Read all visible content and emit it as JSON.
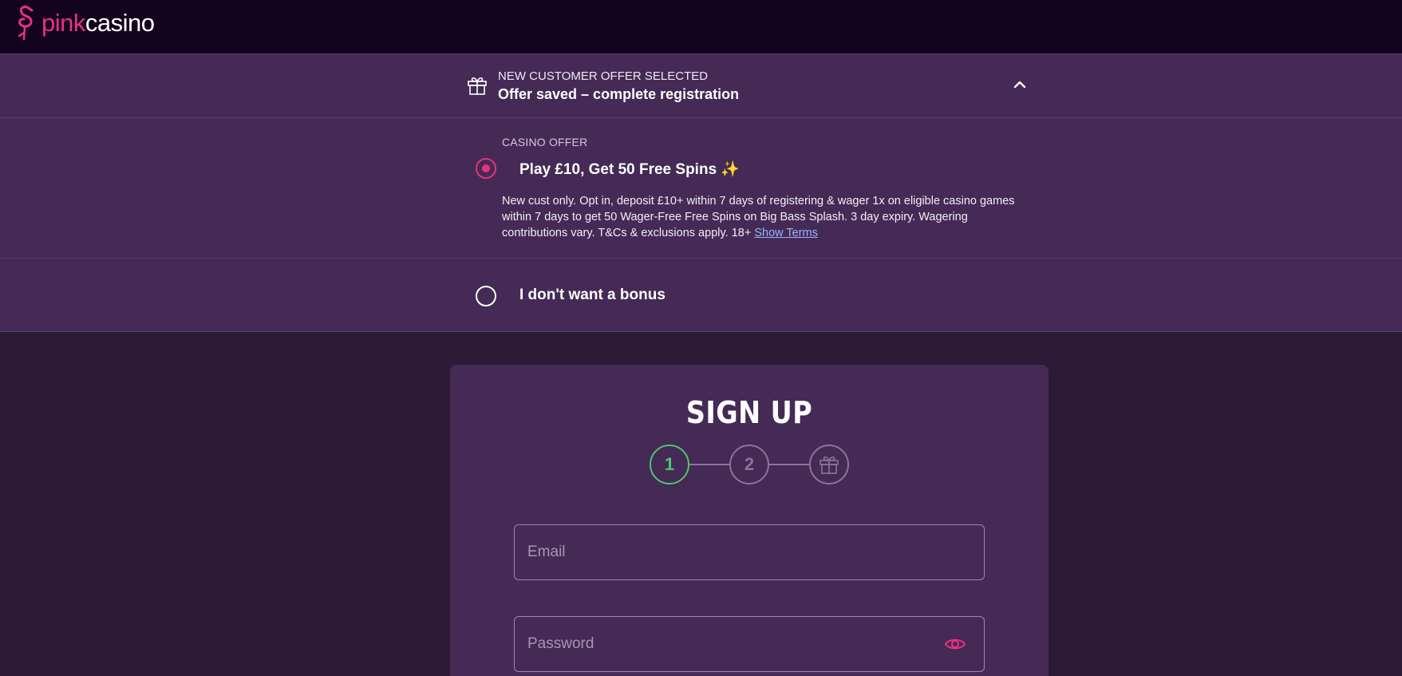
{
  "header": {
    "logo_pink": "pink",
    "logo_white": "casino",
    "logo_icon": "flamingo-icon"
  },
  "offer": {
    "kicker": "NEW CUSTOMER OFFER SELECTED",
    "title": "Offer saved – complete registration",
    "icon": "gift-icon",
    "toggle_icon": "chevron-up-icon",
    "section_label": "CASINO OFFER",
    "options": [
      {
        "title": "Play £10, Get 50 Free Spins",
        "emoji": "✨",
        "selected": true,
        "terms": "New cust only. Opt in, deposit £10+ within 7 days of registering & wager 1x on eligible casino games within 7 days to get 50 Wager-Free Free Spins on Big Bass Splash. 3 day expiry. Wagering contributions vary. T&Cs & exclusions apply. 18+",
        "terms_link": "Show Terms"
      },
      {
        "title": "I don't want a bonus",
        "selected": false
      }
    ]
  },
  "signup": {
    "title": "SIGN UP",
    "steps": [
      "1",
      "2",
      "gift-icon"
    ],
    "active_step": 1,
    "email_placeholder": "Email",
    "password_placeholder": "Password",
    "password_toggle_icon": "eye-icon"
  },
  "colors": {
    "brand_pink": "#e8317e",
    "active_step": "#4fc571",
    "panel": "#442a55",
    "topbar": "#13031f",
    "page": "#2d1a36"
  }
}
